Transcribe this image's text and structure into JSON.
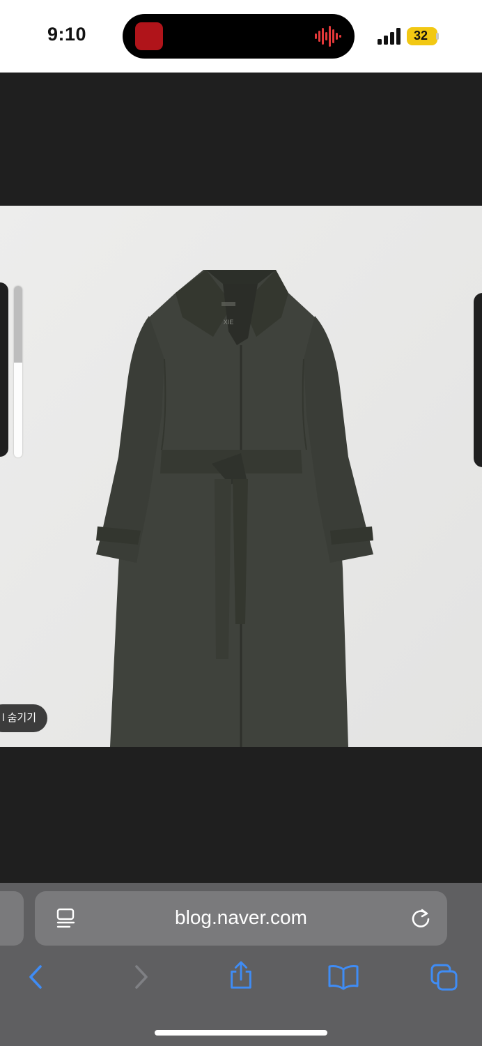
{
  "status_bar": {
    "time": "9:10",
    "battery": "32"
  },
  "photo": {
    "hide_label": "l 숨기기",
    "coat_brand": "XIE"
  },
  "safari": {
    "url": "blog.naver.com"
  },
  "colors": {
    "viewer_background": "#1f1f1f",
    "photo_background": "#e9e9e8",
    "coat": "#3f423c",
    "toolbar": "#5f5f61",
    "url_field": "#7a7a7c",
    "accent_blue": "#3f8cf5",
    "battery_yellow": "#f2c813"
  },
  "icons": [
    "reader-mode-icon",
    "reload-icon",
    "back-icon",
    "forward-icon",
    "share-icon",
    "bookmarks-icon",
    "tabs-icon"
  ]
}
